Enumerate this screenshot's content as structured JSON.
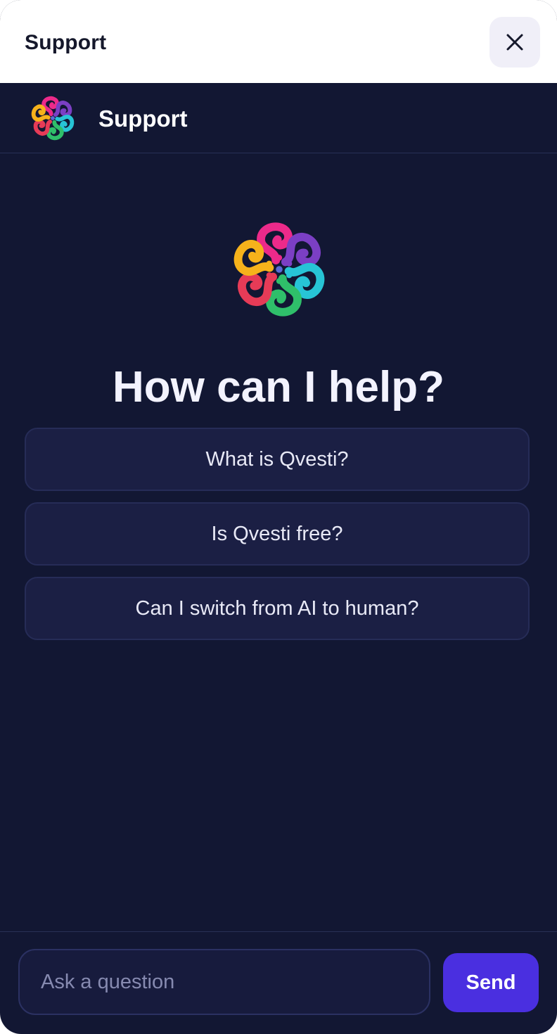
{
  "window": {
    "title": "Support",
    "close_icon": "close-icon"
  },
  "chat": {
    "header_title": "Support",
    "logo_icon": "flower-question-logo",
    "heading": "How can I help?",
    "suggestions": [
      {
        "label": "What is Qvesti?"
      },
      {
        "label": "Is Qvesti free?"
      },
      {
        "label": "Can I switch from AI to human?"
      }
    ]
  },
  "composer": {
    "placeholder": "Ask a question",
    "value": "",
    "send_label": "Send"
  },
  "colors": {
    "background": "#121733",
    "accent": "#4a2fe0",
    "suggestion_bg": "#1b1f44",
    "logo_palette": [
      "#f6b21b",
      "#ec2a8a",
      "#7b3fc4",
      "#27c4d6",
      "#2fbf6a",
      "#e63b57"
    ]
  }
}
